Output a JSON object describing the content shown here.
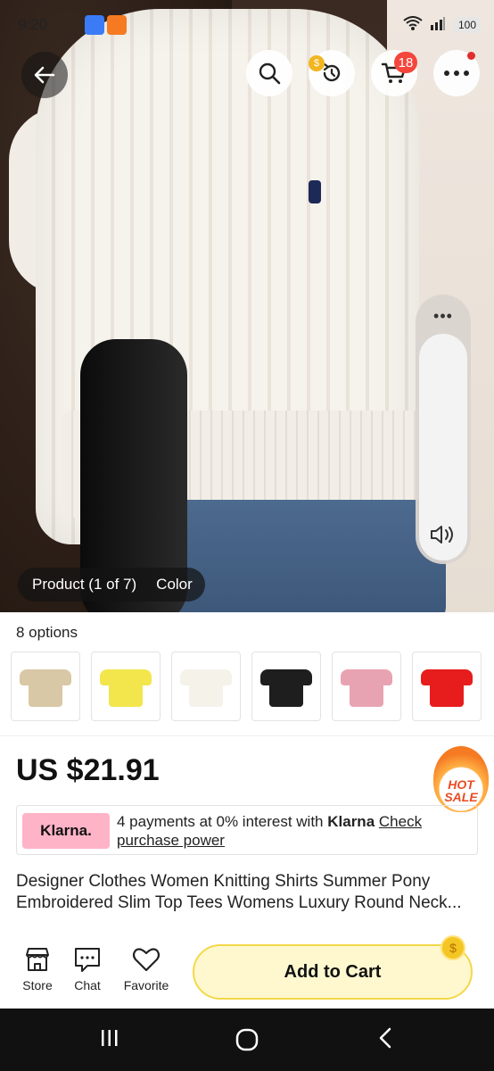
{
  "status_bar": {
    "time": "9:20",
    "battery": "100"
  },
  "header": {
    "cart_count": "18",
    "coin_symbol": "$"
  },
  "product_chip": {
    "product_label": "Product (1 of 7)",
    "color_label": "Color"
  },
  "options": {
    "label": "8 options",
    "colors": [
      "#d9c8a5",
      "#f2e64c",
      "#f5f2ea",
      "#1e1e1e",
      "#e8a3b3",
      "#e71d1d"
    ]
  },
  "price": {
    "value": "US $21.91",
    "hot_line1": "HOT",
    "hot_line2": "SALE"
  },
  "klarna": {
    "logo": "Klarna.",
    "text_prefix": "4 payments at 0% interest with ",
    "brand": "Klarna",
    "link": "Check purchase power"
  },
  "product": {
    "title": "Designer Clothes Women Knitting Shirts Summer Pony Embroidered Slim Top Tees Womens Luxury Round Neck..."
  },
  "bottom_bar": {
    "store_label": "Store",
    "chat_label": "Chat",
    "favorite_label": "Favorite",
    "add_to_cart": "Add to Cart",
    "coin_symbol": "$"
  }
}
